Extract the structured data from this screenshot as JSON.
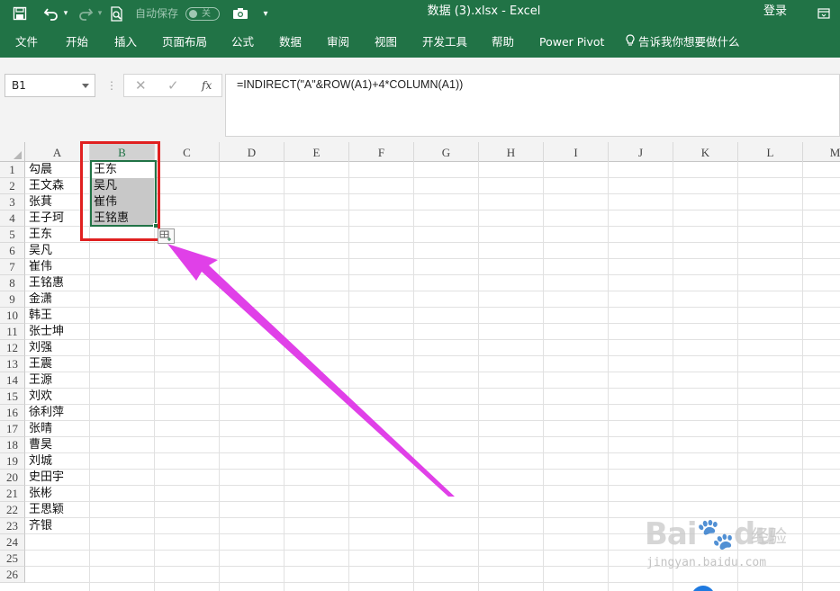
{
  "titlebar": {
    "autosave_label": "自动保存",
    "autosave_state": "关",
    "document_title": "数据 (3).xlsx  -  Excel",
    "signin": "登录"
  },
  "ribbon": {
    "tabs": [
      "文件",
      "开始",
      "插入",
      "页面布局",
      "公式",
      "数据",
      "审阅",
      "视图",
      "开发工具",
      "帮助",
      "Power Pivot",
      "告诉我你想要做什么"
    ]
  },
  "formula_bar": {
    "name_box": "B1",
    "fx_label": "fx",
    "formula": "=INDIRECT(\"A\"&ROW(A1)+4*COLUMN(A1))"
  },
  "grid": {
    "columns": [
      "A",
      "B",
      "C",
      "D",
      "E",
      "F",
      "G",
      "H",
      "I",
      "J",
      "K",
      "L",
      "M"
    ],
    "selected_column": "B",
    "active_cell": "B1",
    "rows": [
      "1",
      "2",
      "3",
      "4",
      "5",
      "6",
      "7",
      "8",
      "9",
      "10",
      "11",
      "12",
      "13",
      "14",
      "15",
      "16",
      "17",
      "18",
      "19",
      "20",
      "21",
      "22",
      "23",
      "24",
      "25",
      "26"
    ],
    "column_a": [
      "勾晨",
      "王文森",
      "张萁",
      "王子珂",
      "王东",
      "吴凡",
      "崔伟",
      "王铭惠",
      "金潇",
      "韩王",
      "张士坤",
      "刘强",
      "王震",
      "王源",
      "刘欢",
      "徐利萍",
      "张晴",
      "曹昊",
      "刘城",
      "史田宇",
      "张彬",
      "王思颖",
      "齐银"
    ],
    "column_b": [
      "王东",
      "吴凡",
      "崔伟",
      "王铭惠"
    ]
  },
  "colors": {
    "excel_green": "#217346",
    "highlight_red": "#e02020",
    "arrow_magenta": "#e040e8"
  },
  "watermark": {
    "brand": "Bai",
    "brand2": "du",
    "cn": "经验",
    "url": "jingyan.baidu.com"
  }
}
